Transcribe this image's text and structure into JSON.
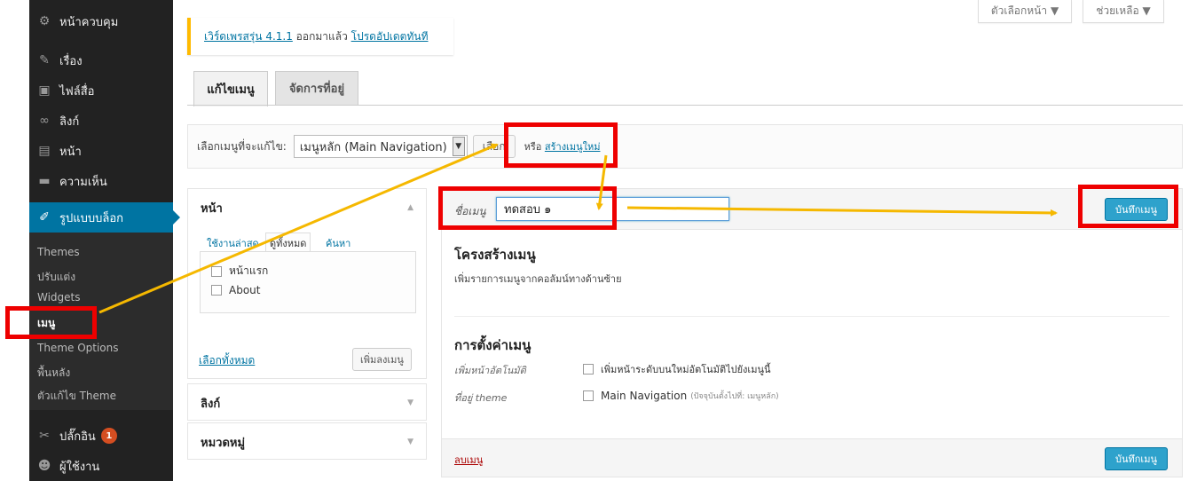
{
  "sidebar": {
    "items": [
      {
        "label": "หน้าควบคุม",
        "icon": "dashboard-icon",
        "glyph": "⚙"
      },
      {
        "label": "เรื่อง",
        "icon": "pin-icon",
        "glyph": "✎"
      },
      {
        "label": "ไฟล์สื่อ",
        "icon": "media-icon",
        "glyph": "▣"
      },
      {
        "label": "ลิงก์",
        "icon": "link-icon",
        "glyph": "∞"
      },
      {
        "label": "หน้า",
        "icon": "page-icon",
        "glyph": "▤"
      },
      {
        "label": "ความเห็น",
        "icon": "comment-icon",
        "glyph": "▬"
      },
      {
        "label": "รูปแบบบล็อก",
        "icon": "appearance-icon",
        "glyph": "✐"
      }
    ],
    "submenu": [
      "Themes",
      "ปรับแต่ง",
      "Widgets",
      "เมนู",
      "Theme Options",
      "พื้นหลัง",
      "ตัวแก้ไข Theme"
    ],
    "plugins": {
      "label": "ปลั๊กอิน",
      "badge": "1",
      "glyph": "✂"
    },
    "users": {
      "label": "ผู้ใช้งาน",
      "glyph": "☻"
    }
  },
  "topbar": {
    "screen_options": "ตัวเลือกหน้า ▼",
    "help": "ช่วยเหลือ ▼"
  },
  "notice": {
    "link1": "เวิร์ดเพรสรุ่น 4.1.1",
    "text": " ออกมาแล้ว ",
    "link2": "โปรดอัปเดตทันที"
  },
  "tabs": {
    "edit": "แก้ไขเมนู",
    "locations": "จัดการที่อยู่"
  },
  "select_bar": {
    "label": "เลือกเมนูที่จะแก้ไข:",
    "selected": "เมนูหลัก (Main Navigation)",
    "select_button": "เลือก",
    "or_text": "หรือ ",
    "create_link": "สร้างเมนูใหม่"
  },
  "pages_panel": {
    "title": "หน้า",
    "tab_recent": "ใช้งานล่าสุด",
    "tab_all": "ดูทั้งหมด",
    "tab_search": "ค้นหา",
    "items": [
      "หน้าแรก",
      "About"
    ],
    "select_all": "เลือกทั้งหมด",
    "add_button": "เพิ่มลงเมนู"
  },
  "links_panel": {
    "title": "ลิงก์"
  },
  "categories_panel": {
    "title": "หมวดหมู่"
  },
  "menu_edit": {
    "name_label": "ชื่อเมนู",
    "name_value": "ทดสอบ ๑",
    "save_button": "บันทึกเมนู",
    "structure_title": "โครงสร้างเมนู",
    "structure_desc": "เพิ่มรายการเมนูจากคอลัมน์ทางด้านซ้าย",
    "settings_title": "การตั้งค่าเมนู",
    "auto_add_label": "เพิ่มหน้าอัตโนมัติ",
    "auto_add_text": "เพิ่มหน้าระดับบนใหม่อัตโนมัติไปยังเมนูนี้",
    "location_label": "ที่อยู่ theme",
    "location_text": "Main Navigation",
    "location_note": "(ปัจจุบันตั้งไปที่: เมนูหลัก)",
    "delete_link": "ลบเมนู"
  },
  "colors": {
    "accent": "#0074a2",
    "button": "#2ea2cc",
    "annotation": "#e00000",
    "arrow": "#f5b800"
  }
}
